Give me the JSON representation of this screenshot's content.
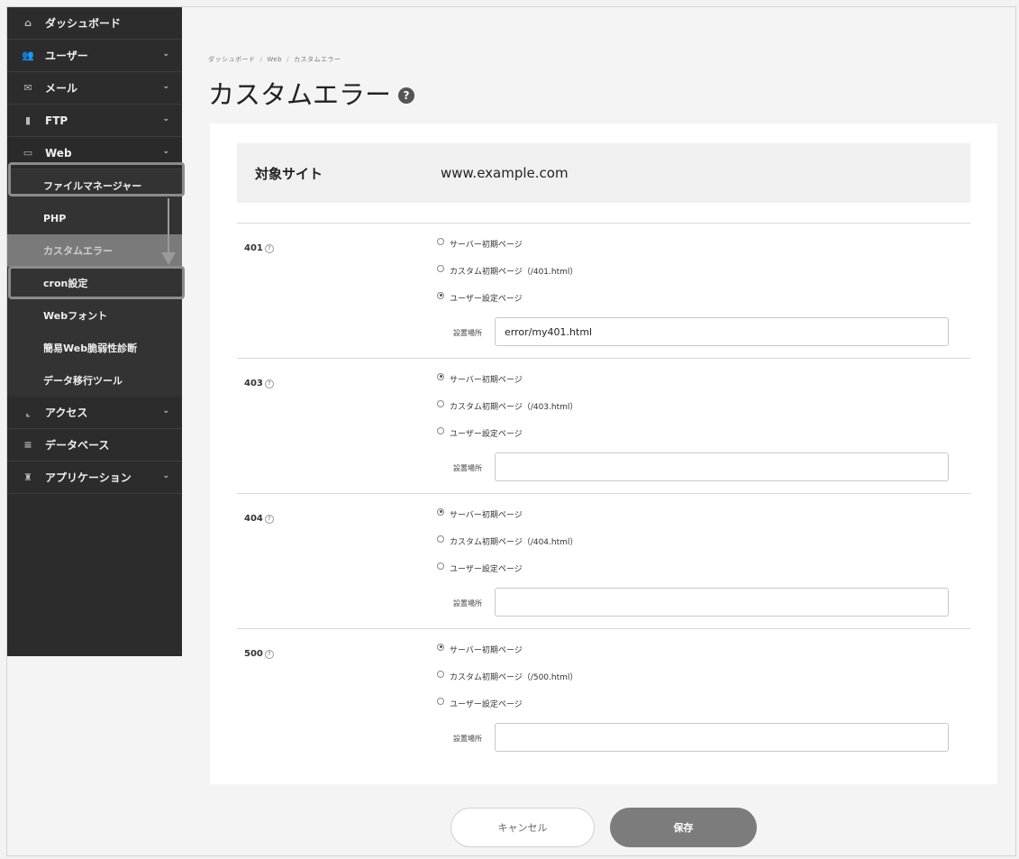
{
  "sidebar": {
    "items": [
      {
        "label": "ダッシュボード",
        "icon": "home-icon",
        "glyph": "⌂",
        "chevron": ""
      },
      {
        "label": "ユーザー",
        "icon": "users-icon",
        "glyph": "👥",
        "chevron": "⌄"
      },
      {
        "label": "メール",
        "icon": "mail-icon",
        "glyph": "✉",
        "chevron": "⌄"
      },
      {
        "label": "FTP",
        "icon": "file-icon",
        "glyph": "▮",
        "chevron": "⌄"
      },
      {
        "label": "Web",
        "icon": "window-icon",
        "glyph": "▭",
        "chevron": "⌄"
      }
    ],
    "web_sub": [
      "ファイルマネージャー",
      "PHP",
      "カスタムエラー",
      "cron設定",
      "Webフォント",
      "簡易Web脆弱性診断",
      "データ移行ツール"
    ],
    "items_after": [
      {
        "label": "アクセス",
        "icon": "chart-icon",
        "glyph": "⌞",
        "chevron": "⌄"
      },
      {
        "label": "データベース",
        "icon": "database-icon",
        "glyph": "≡",
        "chevron": ""
      },
      {
        "label": "アプリケーション",
        "icon": "app-icon",
        "glyph": "♜",
        "chevron": "⌄"
      }
    ]
  },
  "breadcrumb": [
    "ダッシュボード",
    "Web",
    "カスタムエラー"
  ],
  "page": {
    "title": "カスタムエラー",
    "help_glyph": "?"
  },
  "target_site": {
    "label": "対象サイト",
    "value": "www.example.com"
  },
  "sections": [
    {
      "code": "401",
      "options": [
        "サーバー初期ページ",
        "カスタム初期ページ（/401.html）",
        "ユーザー設定ページ"
      ],
      "selected": 2,
      "location_label": "設置場所",
      "location_value": "error/my401.html"
    },
    {
      "code": "403",
      "options": [
        "サーバー初期ページ",
        "カスタム初期ページ（/403.html）",
        "ユーザー設定ページ"
      ],
      "selected": 0,
      "location_label": "設置場所",
      "location_value": ""
    },
    {
      "code": "404",
      "options": [
        "サーバー初期ページ",
        "カスタム初期ページ（/404.html）",
        "ユーザー設定ページ"
      ],
      "selected": 0,
      "location_label": "設置場所",
      "location_value": ""
    },
    {
      "code": "500",
      "options": [
        "サーバー初期ページ",
        "カスタム初期ページ（/500.html）",
        "ユーザー設定ページ"
      ],
      "selected": 0,
      "location_label": "設置場所",
      "location_value": ""
    }
  ],
  "buttons": {
    "cancel": "キャンセル",
    "save": "保存"
  },
  "colors": {
    "sidebar_bg": "#2c2c2c",
    "save_bg": "#7c7c7c",
    "highlight": "#8c8c8c"
  }
}
